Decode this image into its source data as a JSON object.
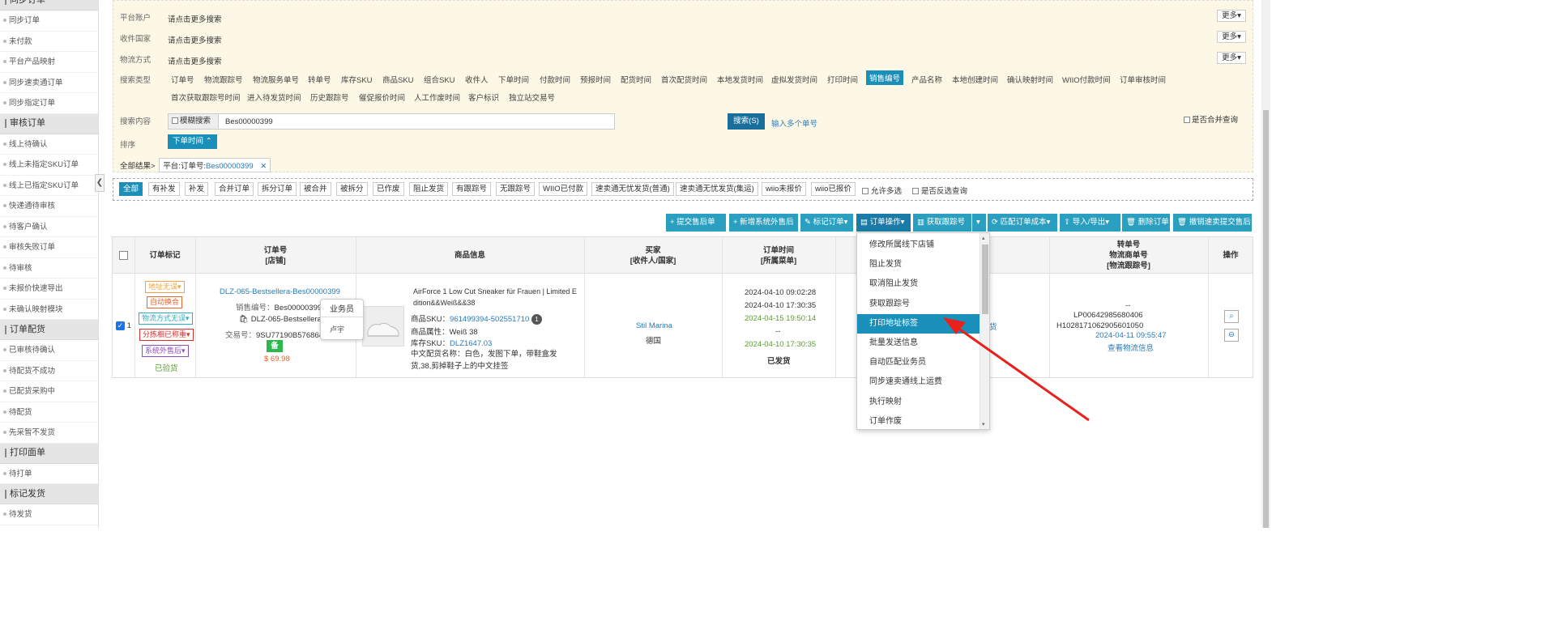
{
  "sidebar": {
    "sections": [
      {
        "title": "同步订单",
        "items": [
          "同步订单",
          "未付款",
          "平台产品映射",
          "同步速卖通订单",
          "同步指定订单"
        ]
      },
      {
        "title": "审核订单",
        "items": [
          "线上待确认",
          "线上未指定SKU订单",
          "线上已指定SKU订单",
          "快递通待审核",
          "待客户确认",
          "审核失败订单",
          "待审核",
          "未报价快速导出",
          "未确认映射模块"
        ]
      },
      {
        "title": "订单配货",
        "items": [
          "已审核待确认",
          "待配货不成功",
          "已配货采购中",
          "待配货",
          "先采暂不发货"
        ]
      },
      {
        "title": "打印面单",
        "items": [
          "待打单"
        ]
      },
      {
        "title": "标记发货",
        "items": [
          "待发货"
        ]
      }
    ],
    "collapse_glyph": "❮"
  },
  "search": {
    "rows": [
      {
        "label": "平台账户",
        "hint": "请点击更多搜索",
        "more": "更多"
      },
      {
        "label": "收件国家",
        "hint": "请点击更多搜索",
        "more": "更多"
      },
      {
        "label": "物流方式",
        "hint": "请点击更多搜索",
        "more": "更多"
      }
    ],
    "type_label": "搜索类型",
    "types_row1": [
      "订单号",
      "物流跟踪号",
      "物流服务单号",
      "转单号",
      "库存SKU",
      "商品SKU",
      "组合SKU",
      "收件人",
      "下单时间",
      "付款时间",
      "预报时间",
      "配货时间",
      "首次配货时间",
      "本地发货时间",
      "虚拟发货时间",
      "打印时间",
      "销售编号",
      "产品名称",
      "本地创建时间",
      "确认映射时间",
      "WIIO付款时间",
      "订单审核时间"
    ],
    "types_row2": [
      "首次获取跟踪号时间",
      "进入待发货时间",
      "历史跟踪号",
      "催促报价时间",
      "人工作废时间",
      "客户标识",
      "独立站交易号"
    ],
    "active_type": "销售编号",
    "content_label": "搜索内容",
    "fuzzy_label": "模糊搜索",
    "query": "Bes00000399",
    "search_btn": "搜索(S)",
    "multi_link": "输入多个单号",
    "merge_label": "是否合并查询",
    "sort_label": "排序",
    "sort_value": "下单时间",
    "sort_glyph": "⌃",
    "result_label": "全部结果>",
    "result_tag_key": "平台:订单号:",
    "result_tag_value": "Bes00000399",
    "result_tag_close": "✕"
  },
  "filters": {
    "tabs": [
      "全部",
      "有补发",
      "补发",
      "合并订单",
      "拆分订单",
      "被合并",
      "被拆分",
      "已作废",
      "阻止发货",
      "有跟踪号",
      "无跟踪号",
      "WIIO已付款",
      "速卖通无忧发货(普通)",
      "速卖通无忧发货(集运)",
      "wiio未报价",
      "wiio已报价"
    ],
    "checks": [
      "允许多选",
      "是否反选查询"
    ]
  },
  "toolbar": [
    "+ 提交售后单",
    "+ 新增系统外售后",
    "✎ 标记订单▾",
    "▤ 订单操作▾",
    "▥ 获取跟踪号",
    "▾",
    "⟳ 匹配订单成本▾",
    "⇪ 导入/导出▾",
    "🗑 删除订单",
    "🗑 撤销速卖提交售后"
  ],
  "table": {
    "headers": {
      "mark": "订单标记",
      "order_l1": "订单号",
      "order_l2": "[店铺]",
      "product": "商品信息",
      "buyer_l1": "买家",
      "buyer_l2": "[收件人/国家]",
      "time_l1": "订单时间",
      "time_l2": "[所属菜单]",
      "transfer_l1": "转单号",
      "transfer_l2": "物流商单号",
      "transfer_l3": "[物流跟踪号]",
      "ops": "操作"
    },
    "row": {
      "index": "1",
      "tags": [
        "地址无误▾",
        "自动换合",
        "物流方式无误▾",
        "分拣相已称重▾",
        "系统外售后▾"
      ],
      "verified": "已验货",
      "order_link": "DLZ-065-Bestsellera-Bes00000399",
      "sales_no_label": "销售编号：",
      "sales_no": "Bes00000399",
      "store": "DLZ-065-Bestsellera",
      "trade_label": "交易号：",
      "trade_no": "9SU77190B5768640",
      "badge": "备",
      "price": "$ 69.98",
      "product_title": "AirForce 1 Low Cut Sneaker für Frauen | Limited E dition&&Weiß&&38",
      "sku_label": "商品SKU：",
      "sku": "961499394-502551710",
      "sku_count": "1",
      "attr_label": "商品属性：",
      "attr": "Weiß 38",
      "stock_label": "库存SKU：",
      "stock_sku": "DLZ1647.03",
      "cn_name_label": "中文配货名称：",
      "cn_name": "白色，发图下单，带鞋盒发货,38,剪掉鞋子上的中文挂签",
      "buyer_name": "Stil Marina",
      "buyer_country": "德国",
      "times": [
        "2024-04-10 09:02:28",
        "2024-04-10 17:30:35",
        "2024-04-15 19:50:14",
        "--",
        "2024-04-10 17:30:35"
      ],
      "status": "已发货",
      "partial": "货",
      "transfer_dash": "--",
      "logistics_no": "LP00642985680406",
      "tracking_no": "H1028171062905601050",
      "tracking_time": "2024-04-11 09:55:47",
      "view_tracking": "查看物流信息"
    }
  },
  "dropdown": {
    "items": [
      "修改所属线下店铺",
      "阻止发货",
      "取消阻止发货",
      "获取跟踪号",
      "打印地址标签",
      "批量发送信息",
      "自动匹配业务员",
      "同步速卖通线上运费",
      "执行映射",
      "订单作废"
    ],
    "active": "打印地址标签"
  },
  "popover": {
    "title": "业务员",
    "name": "卢宇"
  },
  "colors": {
    "accent": "#1a8fb9",
    "annotation_arrow": "#e8211d"
  }
}
